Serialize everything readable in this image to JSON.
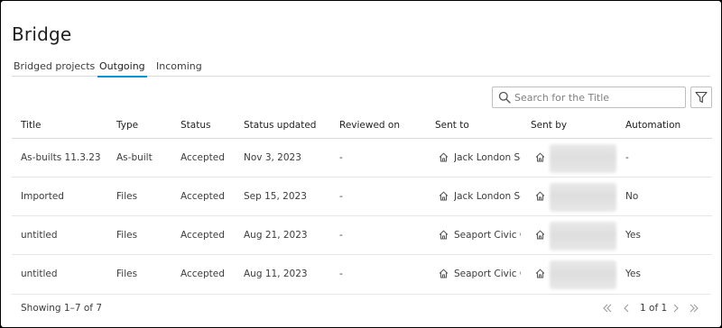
{
  "page": {
    "title": "Bridge"
  },
  "tabs": [
    {
      "label": "Bridged projects",
      "active": false
    },
    {
      "label": "Outgoing",
      "active": true
    },
    {
      "label": "Incoming",
      "active": false
    }
  ],
  "search": {
    "placeholder": "Search for the Title",
    "value": ""
  },
  "icons": {
    "search": "search-icon",
    "filter": "filter-icon",
    "project": "home-icon",
    "first": "first-page-icon",
    "prev": "previous-page-icon",
    "next": "next-page-icon",
    "last": "last-page-icon"
  },
  "colors": {
    "accent": "#0696d7",
    "text": "#3c3c3c",
    "disabled": "#a0a0a0"
  },
  "table": {
    "columns": [
      "Title",
      "Type",
      "Status",
      "Status updated",
      "Reviewed on",
      "Sent to",
      "Sent by",
      "Automation"
    ],
    "rows": [
      {
        "title": "As-builts 11.3.23",
        "type": "As-built",
        "status": "Accepted",
        "status_updated": "Nov 3, 2023",
        "reviewed_on": "-",
        "sent_to": "Jack London Square",
        "automation": "-"
      },
      {
        "title": "Imported",
        "type": "Files",
        "status": "Accepted",
        "status_updated": "Sep 15, 2023",
        "reviewed_on": "-",
        "sent_to": "Jack London Square",
        "automation": "No"
      },
      {
        "title": "untitled",
        "type": "Files",
        "status": "Accepted",
        "status_updated": "Aug 21, 2023",
        "reviewed_on": "-",
        "sent_to": "Seaport Civic Center",
        "automation": "Yes"
      },
      {
        "title": "untitled",
        "type": "Files",
        "status": "Accepted",
        "status_updated": "Aug 11, 2023",
        "reviewed_on": "-",
        "sent_to": "Seaport Civic Center",
        "automation": "Yes"
      }
    ]
  },
  "footer": {
    "showing": "Showing 1–7 of 7",
    "page_of": "1 of 1"
  }
}
